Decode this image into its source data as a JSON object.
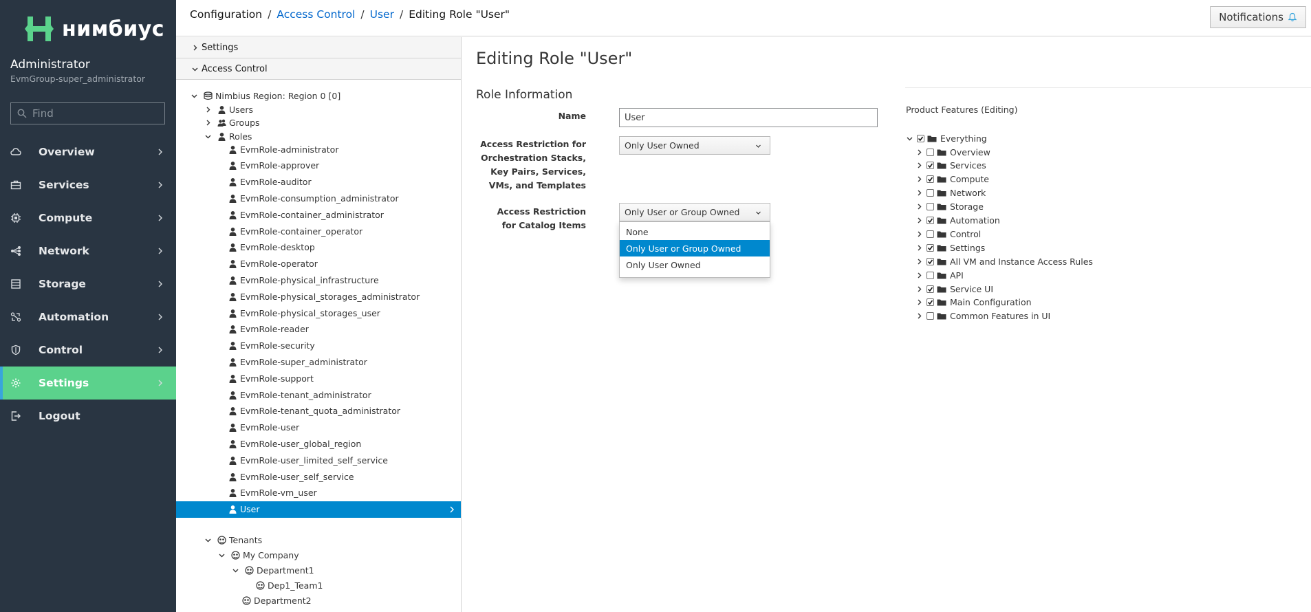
{
  "brand": {
    "name": "нимбиус",
    "accent": "#5bd28c"
  },
  "user": {
    "name": "Administrator",
    "group": "EvmGroup-super_administrator"
  },
  "nav": {
    "search_placeholder": "Find",
    "items": [
      {
        "label": "Overview",
        "icon": "cloud-icon",
        "active": false,
        "chevron": true
      },
      {
        "label": "Services",
        "icon": "briefcase-icon",
        "active": false,
        "chevron": true
      },
      {
        "label": "Compute",
        "icon": "cpu-icon",
        "active": false,
        "chevron": true
      },
      {
        "label": "Network",
        "icon": "network-icon",
        "active": false,
        "chevron": true
      },
      {
        "label": "Storage",
        "icon": "database-icon",
        "active": false,
        "chevron": true
      },
      {
        "label": "Automation",
        "icon": "automation-icon",
        "active": false,
        "chevron": true
      },
      {
        "label": "Control",
        "icon": "shield-icon",
        "active": false,
        "chevron": true
      },
      {
        "label": "Settings",
        "icon": "gear-icon",
        "active": true,
        "chevron": true
      },
      {
        "label": "Logout",
        "icon": "logout-icon",
        "active": false,
        "chevron": false
      }
    ]
  },
  "breadcrumb": [
    {
      "label": "Configuration",
      "link": false
    },
    {
      "label": "Access Control",
      "link": true
    },
    {
      "label": "User",
      "link": true
    },
    {
      "label": "Editing Role \"User\"",
      "link": false
    }
  ],
  "notifications": {
    "label": "Notifications"
  },
  "accordion": {
    "settings_label": "Settings",
    "access_control_label": "Access Control"
  },
  "tree": {
    "region": "Nimbius Region: Region 0 [0]",
    "users": "Users",
    "groups": "Groups",
    "roles": "Roles",
    "role_items": [
      "EvmRole-administrator",
      "EvmRole-approver",
      "EvmRole-auditor",
      "EvmRole-consumption_administrator",
      "EvmRole-container_administrator",
      "EvmRole-container_operator",
      "EvmRole-desktop",
      "EvmRole-operator",
      "EvmRole-physical_infrastructure",
      "EvmRole-physical_storages_administrator",
      "EvmRole-physical_storages_user",
      "EvmRole-reader",
      "EvmRole-security",
      "EvmRole-super_administrator",
      "EvmRole-support",
      "EvmRole-tenant_administrator",
      "EvmRole-tenant_quota_administrator",
      "EvmRole-user",
      "EvmRole-user_global_region",
      "EvmRole-user_limited_self_service",
      "EvmRole-user_self_service",
      "EvmRole-vm_user",
      "User"
    ],
    "selected_role": "User",
    "tenants": "Tenants",
    "my_company": "My Company",
    "department1": "Department1",
    "dep1_team1": "Dep1_Team1",
    "department2": "Department2"
  },
  "form": {
    "title": "Editing Role \"User\"",
    "section": "Role Information",
    "name_label": "Name",
    "name_value": "User",
    "vm_restriction_label": "Access Restriction for Orchestration Stacks, Key Pairs, Services, VMs, and Templates",
    "vm_restriction_value": "Only User Owned",
    "catalog_restriction_label": "Access Restriction for Catalog Items",
    "catalog_restriction_value": "Only User or Group Owned",
    "catalog_options": [
      "None",
      "Only User or Group Owned",
      "Only User Owned"
    ],
    "catalog_highlighted": "Only User or Group Owned"
  },
  "features": {
    "title": "Product Features (Editing)",
    "root": {
      "label": "Everything",
      "checked": true
    },
    "items": [
      {
        "label": "Overview",
        "checked": false
      },
      {
        "label": "Services",
        "checked": true
      },
      {
        "label": "Compute",
        "checked": true
      },
      {
        "label": "Network",
        "checked": false
      },
      {
        "label": "Storage",
        "checked": false
      },
      {
        "label": "Automation",
        "checked": true
      },
      {
        "label": "Control",
        "checked": false
      },
      {
        "label": "Settings",
        "checked": true
      },
      {
        "label": "All VM and Instance Access Rules",
        "checked": true
      },
      {
        "label": "API",
        "checked": false
      },
      {
        "label": "Service UI",
        "checked": true
      },
      {
        "label": "Main Configuration",
        "checked": true
      },
      {
        "label": "Common Features in UI",
        "checked": false
      }
    ]
  }
}
